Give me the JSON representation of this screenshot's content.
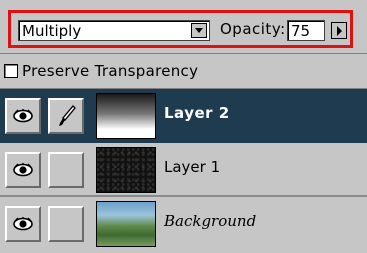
{
  "options": {
    "blend_mode": "Multiply",
    "opacity_label": "Opacity:",
    "opacity_value": "75",
    "highlight_color": "#e01010"
  },
  "preserve_transparency": {
    "label": "Preserve Transparency",
    "checked": false
  },
  "layers": [
    {
      "name": "Layer 2",
      "selected": true,
      "visible": true,
      "brush_linked": true,
      "thumbnail": "white-black-gradient"
    },
    {
      "name": "Layer 1",
      "selected": false,
      "visible": true,
      "brush_linked": false,
      "thumbnail": "dark-noise"
    },
    {
      "name": "Background",
      "selected": false,
      "visible": true,
      "brush_linked": false,
      "thumbnail": "landscape"
    }
  ],
  "icons": {
    "eye": "eye-icon",
    "brush": "paintbrush-icon"
  },
  "colors": {
    "selected_row": "#1f3b50",
    "panel": "#c6c6c6"
  }
}
